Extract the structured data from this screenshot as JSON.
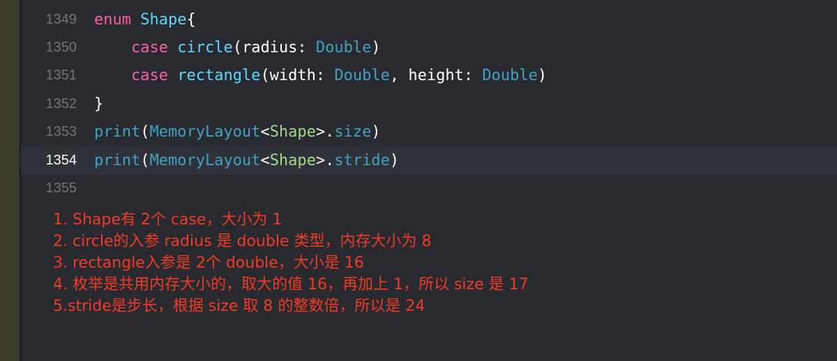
{
  "colors": {
    "background": "#292a30",
    "keyword": "#fc5fa3",
    "type": "#5dd8ff",
    "library_member": "#41a1c0",
    "user_type": "#a3d68b",
    "annotation": "#f13b26"
  },
  "editor": {
    "lines": [
      {
        "number": "1349",
        "tokens": [
          "enum",
          " ",
          "Shape",
          "{"
        ]
      },
      {
        "number": "1350",
        "tokens": [
          "    ",
          "case",
          " ",
          "circle",
          "(radius: ",
          "Double",
          ")"
        ]
      },
      {
        "number": "1351",
        "tokens": [
          "    ",
          "case",
          " ",
          "rectangle",
          "(width: ",
          "Double",
          ", height: ",
          "Double",
          ")"
        ]
      },
      {
        "number": "1352",
        "tokens": [
          "}"
        ]
      },
      {
        "number": "1353",
        "tokens": [
          "print",
          "(",
          "MemoryLayout",
          "<",
          "Shape",
          ">.",
          "size",
          ")"
        ]
      },
      {
        "number": "1354",
        "tokens": [
          "print",
          "(",
          "MemoryLayout",
          "<",
          "Shape",
          ">.",
          "stride",
          ")"
        ]
      },
      {
        "number": "1355",
        "tokens": []
      }
    ],
    "current_line": "1354"
  },
  "annotations": [
    "1. Shape有 2个 case，大小为 1",
    "2. circle的入参 radius 是 double 类型，内存大小为 8",
    "3. rectangle入参是 2个 double，大小是 16",
    "4. 枚举是共用内存大小的，取大的值 16，再加上 1，所以 size 是 17",
    "5.stride是步长，根据 size 取 8 的整数倍，所以是 24"
  ]
}
